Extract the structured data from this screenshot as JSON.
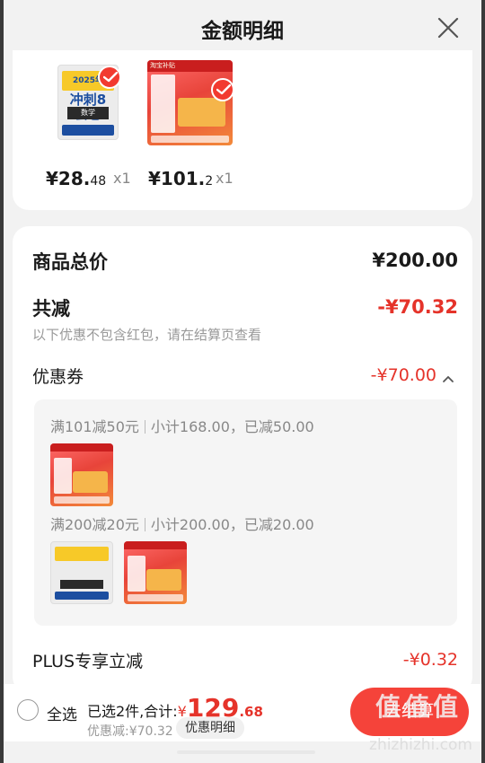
{
  "header": {
    "title": "金额明细",
    "close_icon": "close-icon"
  },
  "products": [
    {
      "cover_year": "2025年",
      "cover_main": "冲刺8套卷",
      "cover_sub": "数学",
      "price_int": "¥28.",
      "price_dec": "48",
      "qty": "x1",
      "selected": true
    },
    {
      "cover_tag": "淘宝补贴",
      "price_int": "¥101.",
      "price_dec": "2",
      "qty": "x1",
      "selected": true
    }
  ],
  "summary": {
    "total_label": "商品总价",
    "total_value": "¥200.00",
    "reduce_label": "共减",
    "reduce_value": "-¥70.32",
    "note": "以下优惠不包含红包，请在结算页查看",
    "coupon_label": "优惠券",
    "coupon_value": "-¥70.00",
    "coupons": [
      {
        "rule": "满101减50元",
        "detail": "小计168.00，已减50.00"
      },
      {
        "rule": "满200减20元",
        "detail": "小计200.00，已减20.00"
      }
    ],
    "plus_label": "PLUS专享立减",
    "plus_value": "-¥0.32"
  },
  "bottom_bar": {
    "select_all": "全选",
    "selected_text": "已选2件,合计:",
    "total_symbol": "¥",
    "total_int": "129",
    "total_dec": ".68",
    "discount_text": "优惠减:¥70.32",
    "detail_button": "优惠明细",
    "checkout": "去结算"
  },
  "watermark": {
    "brand": "值值值",
    "url": "zhizhizhi.com"
  },
  "colors": {
    "accent": "#e5332a",
    "checkout": "#f5433a",
    "background": "#f2f2f2"
  }
}
